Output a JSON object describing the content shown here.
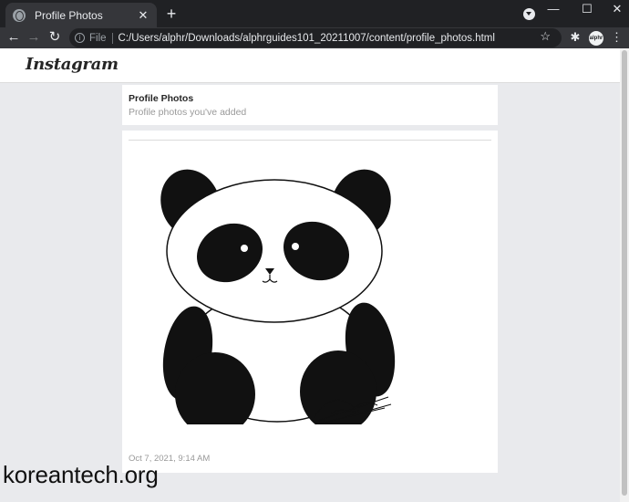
{
  "browser": {
    "tab_title": "Profile Photos",
    "tab_close": "✕",
    "new_tab": "+",
    "window_controls": {
      "minimize": "—",
      "maximize": "☐",
      "close": "✕"
    },
    "nav": {
      "back": "←",
      "forward": "→",
      "reload": "↻"
    },
    "omnibox": {
      "info": "i",
      "scheme_label": "File",
      "url": "C:/Users/alphr/Downloads/alphrguides101_20211007/content/profile_photos.html"
    },
    "star": "☆",
    "extensions": "✱",
    "profile_label": "alphr",
    "menu": "⋮"
  },
  "page": {
    "brand": "Instagram",
    "section": {
      "heading": "Profile Photos",
      "subheading": "Profile photos you've added"
    },
    "photo": {
      "image_name": "panda-drawing",
      "timestamp": "Oct 7, 2021, 9:14 AM"
    }
  },
  "watermark": "koreantech.org"
}
